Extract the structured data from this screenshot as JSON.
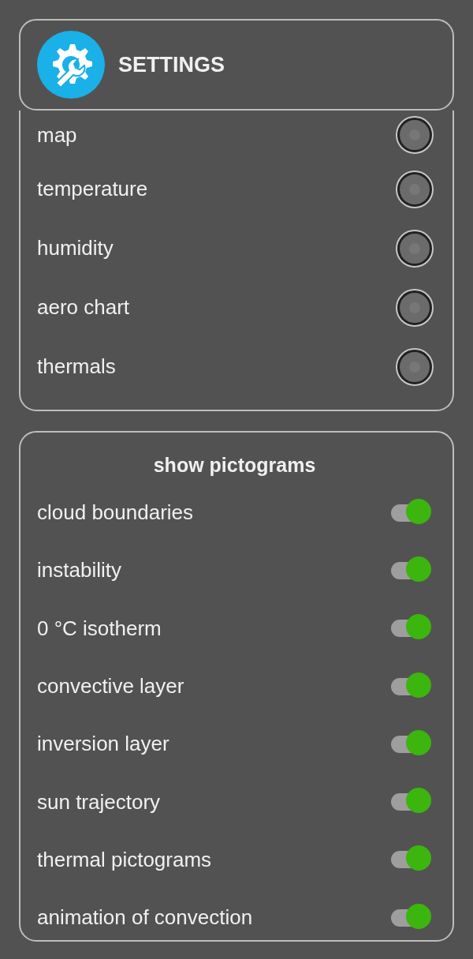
{
  "header": {
    "title": "SETTINGS"
  },
  "layers": [
    {
      "label": "map",
      "selected": false
    },
    {
      "label": "temperature",
      "selected": false
    },
    {
      "label": "humidity",
      "selected": false
    },
    {
      "label": "aero chart",
      "selected": false
    },
    {
      "label": "thermals",
      "selected": false
    }
  ],
  "pictograms": {
    "title": "show pictograms",
    "items": [
      {
        "label": "cloud boundaries",
        "on": true
      },
      {
        "label": "instability",
        "on": true
      },
      {
        "label": "0 °C isotherm",
        "on": true
      },
      {
        "label": "convective layer",
        "on": true
      },
      {
        "label": "inversion layer",
        "on": true
      },
      {
        "label": "sun trajectory",
        "on": true
      },
      {
        "label": "thermal pictograms",
        "on": true
      },
      {
        "label": "animation of convection",
        "on": true
      }
    ]
  }
}
